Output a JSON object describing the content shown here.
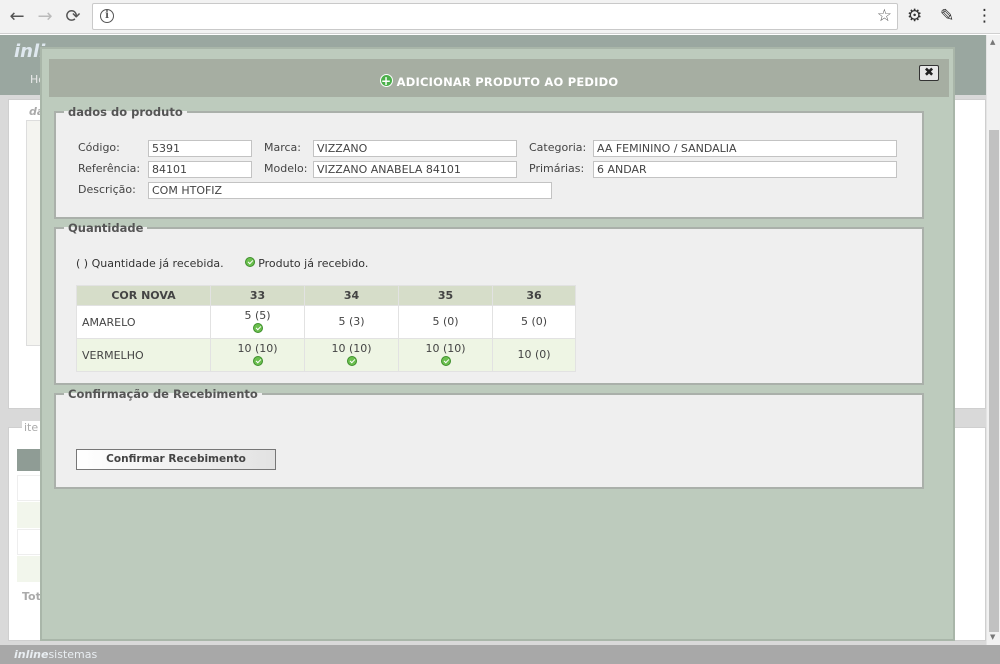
{
  "browser": {
    "url": "",
    "back_icon": "←",
    "forward_icon": "→",
    "reload_icon": "⟳",
    "info_icon": "i",
    "star_icon": "☆",
    "settings_icon": "⚙",
    "eyedropper_icon": "✎",
    "menu_icon": "⋮"
  },
  "background": {
    "logo": "inline",
    "menu_text": "Ho",
    "panel_label": "da",
    "items_legend": "ite",
    "total_label": "Tot",
    "footer_brand_bold": "inline",
    "footer_brand_rest": "sistemas"
  },
  "modal": {
    "title": "ADICIONAR PRODUTO AO PEDIDO",
    "close_symbol": "✖",
    "product": {
      "legend": "dados do produto",
      "codigo_label": "Código:",
      "codigo": "5391",
      "marca_label": "Marca:",
      "marca": "VIZZANO",
      "categoria_label": "Categoria:",
      "categoria": "AA FEMININO / SANDALIA",
      "referencia_label": "Referência:",
      "referencia": "84101",
      "modelo_label": "Modelo:",
      "modelo": "VIZZANO ANABELA 84101",
      "primarias_label": "Primárias:",
      "primarias": "6 ANDAR",
      "descricao_label": "Descrição:",
      "descricao": "COM HTOFIZ"
    },
    "quantity": {
      "legend": "Quantidade",
      "note_received_qty": "( ) Quantidade já recebida.",
      "note_received_product": "Produto já recebido.",
      "headers": [
        "COR NOVA",
        "33",
        "34",
        "35",
        "36"
      ],
      "rows": [
        {
          "name": "AMARELO",
          "cells": [
            {
              "text": "5 (5)",
              "received": true
            },
            {
              "text": "5 (3)",
              "received": false
            },
            {
              "text": "5 (0)",
              "received": false
            },
            {
              "text": "5 (0)",
              "received": false
            }
          ]
        },
        {
          "name": "VERMELHO",
          "cells": [
            {
              "text": "10 (10)",
              "received": true
            },
            {
              "text": "10 (10)",
              "received": true
            },
            {
              "text": "10 (10)",
              "received": true
            },
            {
              "text": "10 (0)",
              "received": false
            }
          ]
        }
      ]
    },
    "confirmation": {
      "legend": "Confirmação de Recebimento",
      "button_label": "Confirmar Recebimento"
    }
  }
}
